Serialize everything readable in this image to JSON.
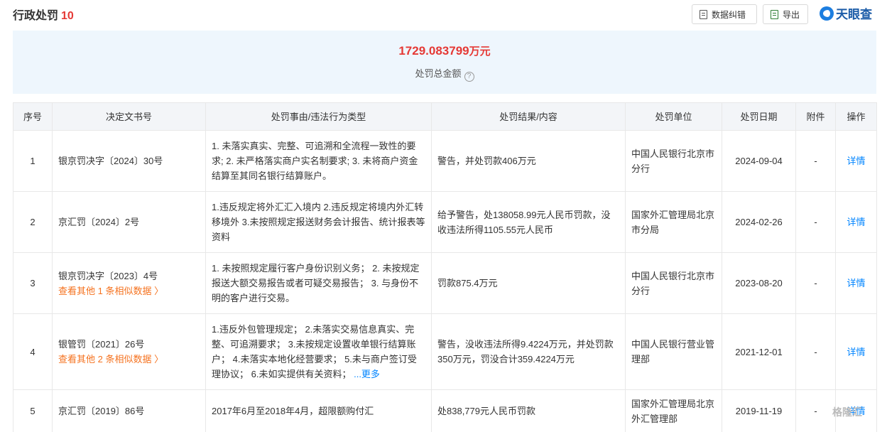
{
  "header": {
    "title": "行政处罚",
    "count": "10",
    "correct_label": "数据纠错",
    "export_label": "导出",
    "logo_text": "天眼查"
  },
  "summary": {
    "amount": "1729.083799",
    "unit": "万元",
    "label": "处罚总金额",
    "help": "?"
  },
  "table": {
    "columns": [
      "序号",
      "决定文书号",
      "处罚事由/违法行为类型",
      "处罚结果/内容",
      "处罚单位",
      "处罚日期",
      "附件",
      "操作"
    ],
    "rows": [
      {
        "no": "1",
        "doc": "银京罚决字〔2024〕30号",
        "similar": "",
        "reason": "1. 未落实真实、完整、可追溯和全流程一致性的要求; 2. 未严格落实商户实名制要求; 3. 未将商户资金结算至其同名银行结算账户。",
        "more": "",
        "result": "警告，并处罚款406万元",
        "unit": "中国人民银行北京市分行",
        "date": "2024-09-04",
        "attach": "-",
        "action": "详情"
      },
      {
        "no": "2",
        "doc": "京汇罚〔2024〕2号",
        "similar": "",
        "reason": "1.违反规定将外汇汇入境内 2.违反规定将境内外汇转移境外 3.未按照规定报送财务会计报告、统计报表等资料",
        "more": "",
        "result": "给予警告，处138058.99元人民币罚款，没收违法所得1105.55元人民币",
        "unit": "国家外汇管理局北京市分局",
        "date": "2024-02-26",
        "attach": "-",
        "action": "详情"
      },
      {
        "no": "3",
        "doc": "银京罚决字〔2023〕4号",
        "similar": "查看其他 1 条相似数据 〉",
        "reason": "1. 未按照规定履行客户身份识别义务； 2. 未按规定报送大额交易报告或者可疑交易报告； 3. 与身份不明的客户进行交易。",
        "more": "",
        "result": "罚款875.4万元",
        "unit": "中国人民银行北京市分行",
        "date": "2023-08-20",
        "attach": "-",
        "action": "详情"
      },
      {
        "no": "4",
        "doc": "银管罚〔2021〕26号",
        "similar": "查看其他 2 条相似数据 〉",
        "reason": "1.违反外包管理规定； 2.未落实交易信息真实、完整、可追溯要求； 3.未按规定设置收单银行结算账户； 4.未落实本地化经营要求； 5.未与商户签订受理协议； 6.未如实提供有关资料；",
        "more": "...更多",
        "result": "警告，没收违法所得9.4224万元，并处罚款350万元，罚没合计359.4224万元",
        "unit": "中国人民银行营业管理部",
        "date": "2021-12-01",
        "attach": "-",
        "action": "详情"
      },
      {
        "no": "5",
        "doc": "京汇罚〔2019〕86号",
        "similar": "",
        "reason": "2017年6月至2018年4月，超限额购付汇",
        "more": "",
        "result": "处838,779元人民币罚款",
        "unit": "国家外汇管理局北京外汇管理部",
        "date": "2019-11-19",
        "attach": "-",
        "action": "详情"
      }
    ]
  },
  "watermark": "格隆汇"
}
